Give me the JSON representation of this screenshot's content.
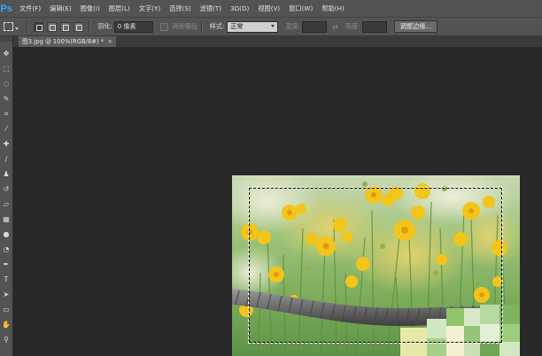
{
  "app": {
    "logo": "Ps"
  },
  "menu": [
    "文件(F)",
    "编辑(E)",
    "图像(I)",
    "图层(L)",
    "文字(Y)",
    "选择(S)",
    "滤镜(T)",
    "3D(D)",
    "视图(V)",
    "窗口(W)",
    "帮助(H)"
  ],
  "options": {
    "feather_label": "羽化:",
    "feather_value": "0 像素",
    "antialias_label": "消除锯齿",
    "style_label": "样式:",
    "style_value": "正常",
    "width_label": "宽度:",
    "height_label": "高度:",
    "adjust_edge_label": "调整边缘..."
  },
  "document": {
    "tab_title": "图3.jpg @ 100%(RGB/8#) *",
    "close_glyph": "×"
  },
  "tools": [
    {
      "name": "move-tool-icon",
      "glyph": "✥"
    },
    {
      "name": "marquee-tool-icon",
      "glyph": "⬚"
    },
    {
      "name": "lasso-tool-icon",
      "glyph": "◌"
    },
    {
      "name": "quick-select-tool-icon",
      "glyph": "✎"
    },
    {
      "name": "crop-tool-icon",
      "glyph": "⌗"
    },
    {
      "name": "eyedropper-tool-icon",
      "glyph": "⁄"
    },
    {
      "name": "healing-brush-icon",
      "glyph": "✚"
    },
    {
      "name": "brush-tool-icon",
      "glyph": "∕"
    },
    {
      "name": "clone-stamp-icon",
      "glyph": "♟"
    },
    {
      "name": "history-brush-icon",
      "glyph": "↺"
    },
    {
      "name": "eraser-tool-icon",
      "glyph": "▱"
    },
    {
      "name": "gradient-tool-icon",
      "glyph": "▦"
    },
    {
      "name": "blur-tool-icon",
      "glyph": "●"
    },
    {
      "name": "dodge-tool-icon",
      "glyph": "◔"
    },
    {
      "name": "pen-tool-icon",
      "glyph": "✒"
    },
    {
      "name": "type-tool-icon",
      "glyph": "T"
    },
    {
      "name": "path-select-icon",
      "glyph": "➤"
    },
    {
      "name": "shape-tool-icon",
      "glyph": "▭"
    },
    {
      "name": "hand-tool-icon",
      "glyph": "✋"
    },
    {
      "name": "zoom-tool-icon",
      "glyph": "⚲"
    }
  ]
}
